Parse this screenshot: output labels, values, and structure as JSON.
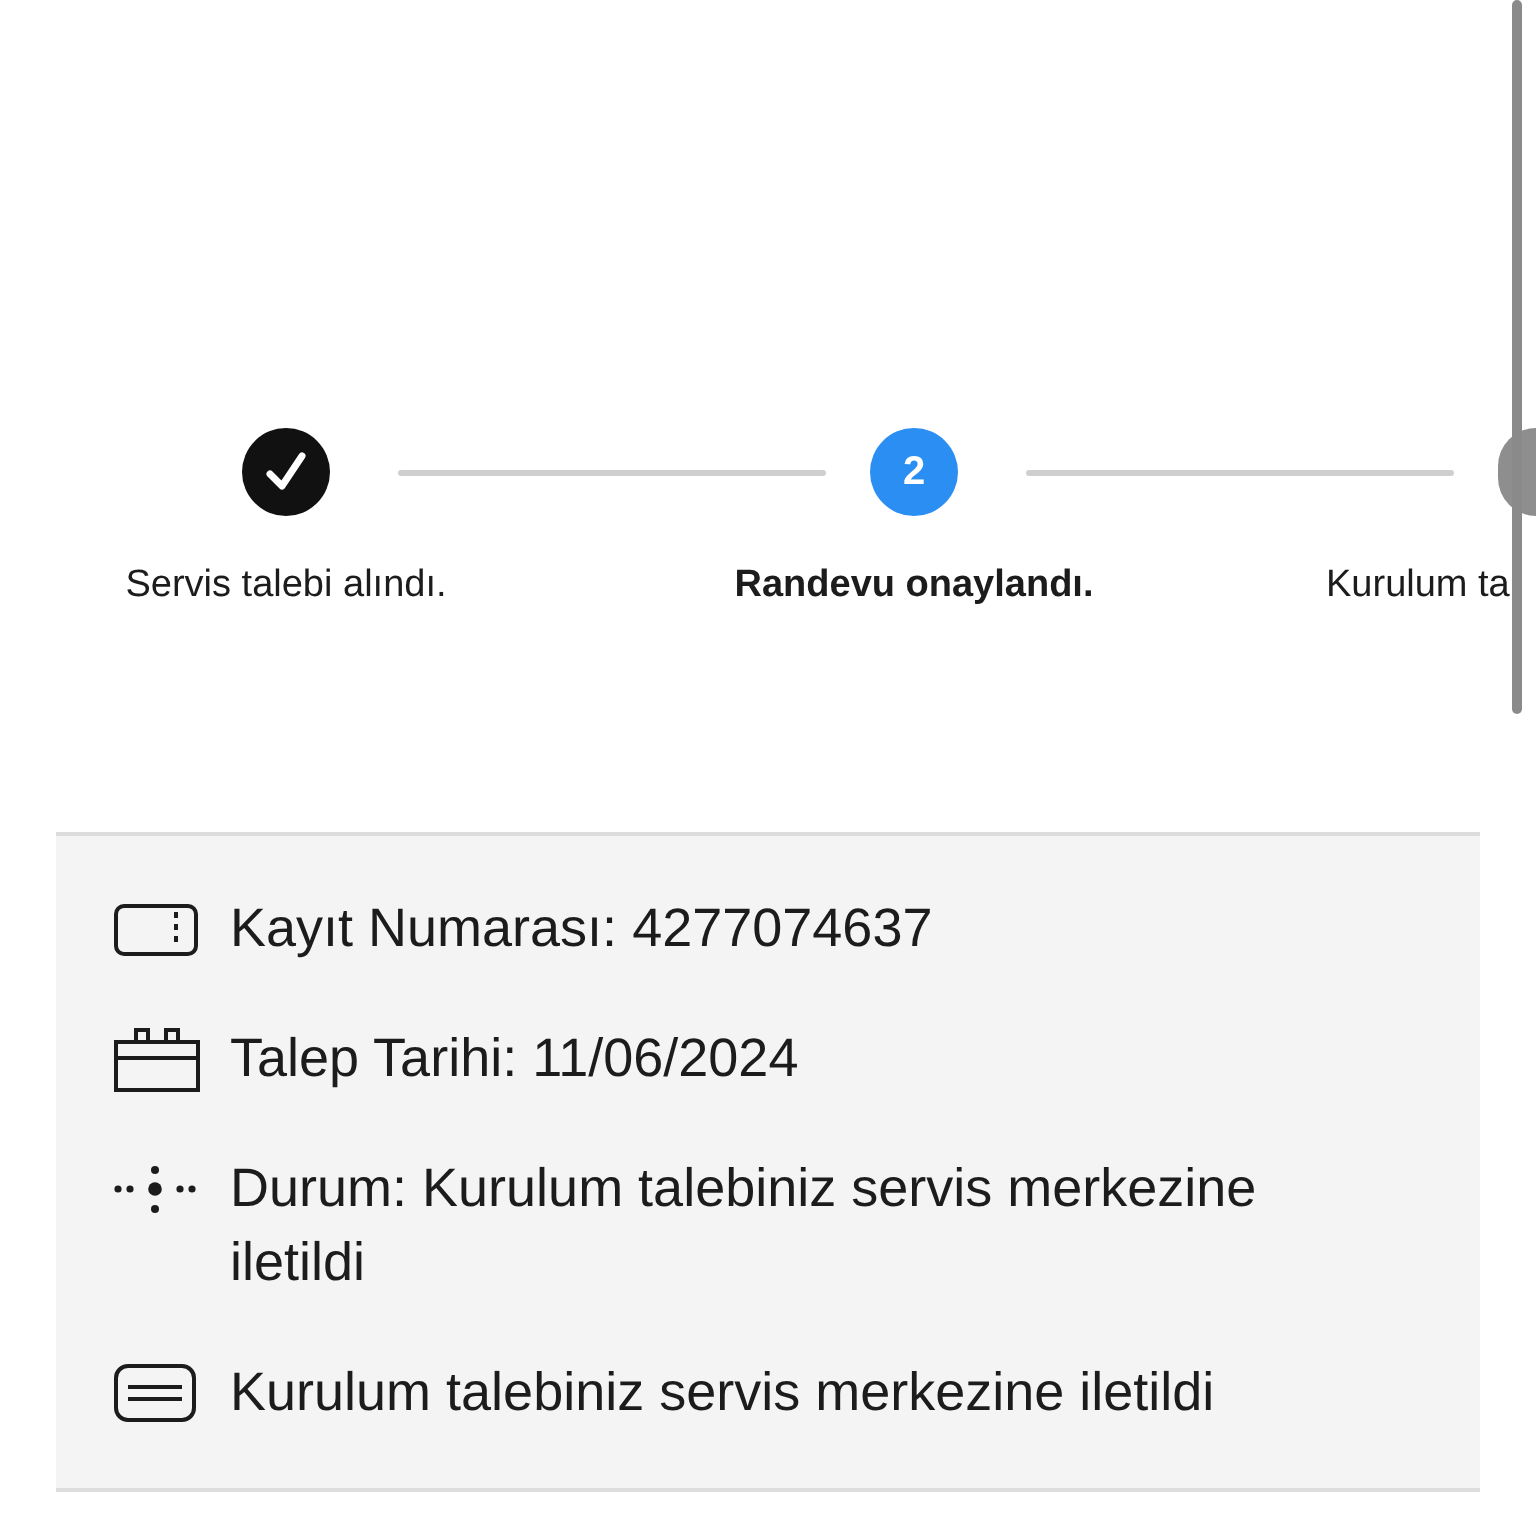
{
  "steps": [
    {
      "label": "Servis talebi alındı.",
      "kind": "done"
    },
    {
      "label": "Randevu onaylandı.",
      "kind": "current",
      "number": "2"
    },
    {
      "label": "Kurulum ta",
      "kind": "pending"
    }
  ],
  "details": [
    {
      "kind": "ticket",
      "text": "Kayıt Numarası: 4277074637"
    },
    {
      "kind": "calendar",
      "text": "Talep Tarihi: 11/06/2024"
    },
    {
      "kind": "progress",
      "text": "Durum: Kurulum talebiniz servis merkezine iletildi"
    },
    {
      "kind": "message",
      "text": "Kurulum talebiniz servis merkezine iletildi"
    }
  ]
}
